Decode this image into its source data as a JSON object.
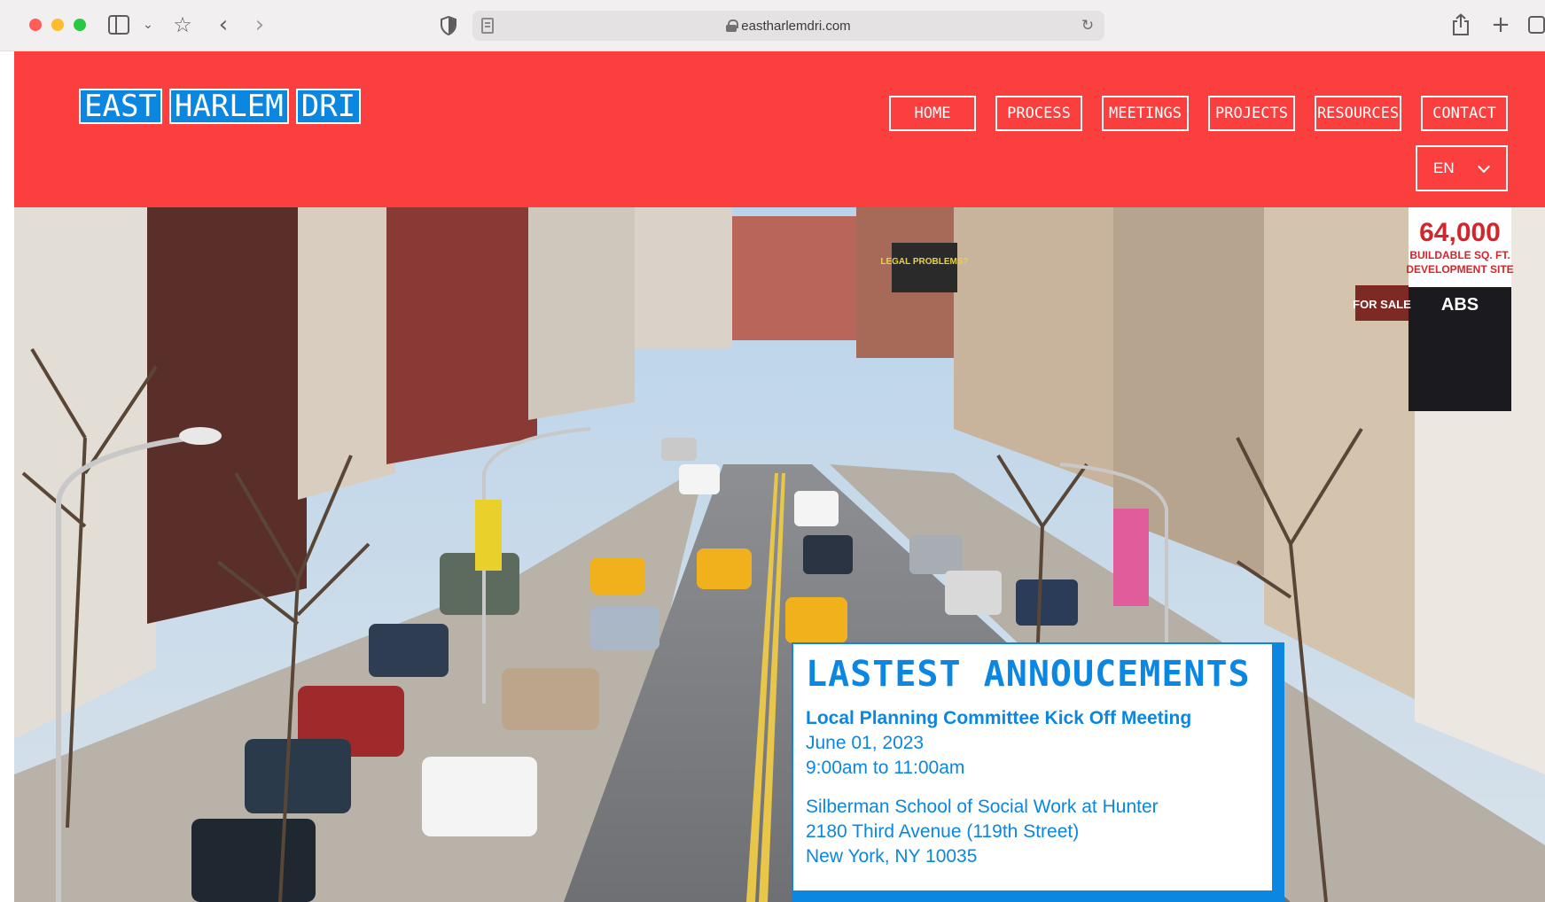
{
  "browser": {
    "url": "eastharlemdri.com"
  },
  "site": {
    "logo_words": [
      "EAST",
      "HARLEM",
      "DRI"
    ],
    "nav": [
      "HOME",
      "PROCESS",
      "MEETINGS",
      "PROJECTS",
      "RESOURCES",
      "CONTACT"
    ],
    "language": "EN"
  },
  "hero": {
    "sign_price": "64,000",
    "sign_line1": "BUILDABLE SQ. FT.",
    "sign_line2": "DEVELOPMENT SITE",
    "sign_brand": "ABS",
    "for_sale": "FOR SALE",
    "billboard": "LEGAL PROBLEMS?"
  },
  "announcements": {
    "title": "LASTEST ANNOUCEMENTS",
    "event": {
      "name": "Local Planning Committee Kick Off Meeting",
      "date": "June 01, 2023",
      "time": "9:00am to 11:00am",
      "venue": "Silberman School of Social Work at Hunter",
      "address": "2180 Third Avenue (119th Street)",
      "city": "New York, NY 10035"
    }
  },
  "colors": {
    "header_red": "#fb3f3f",
    "brand_blue": "#0b86e1"
  }
}
